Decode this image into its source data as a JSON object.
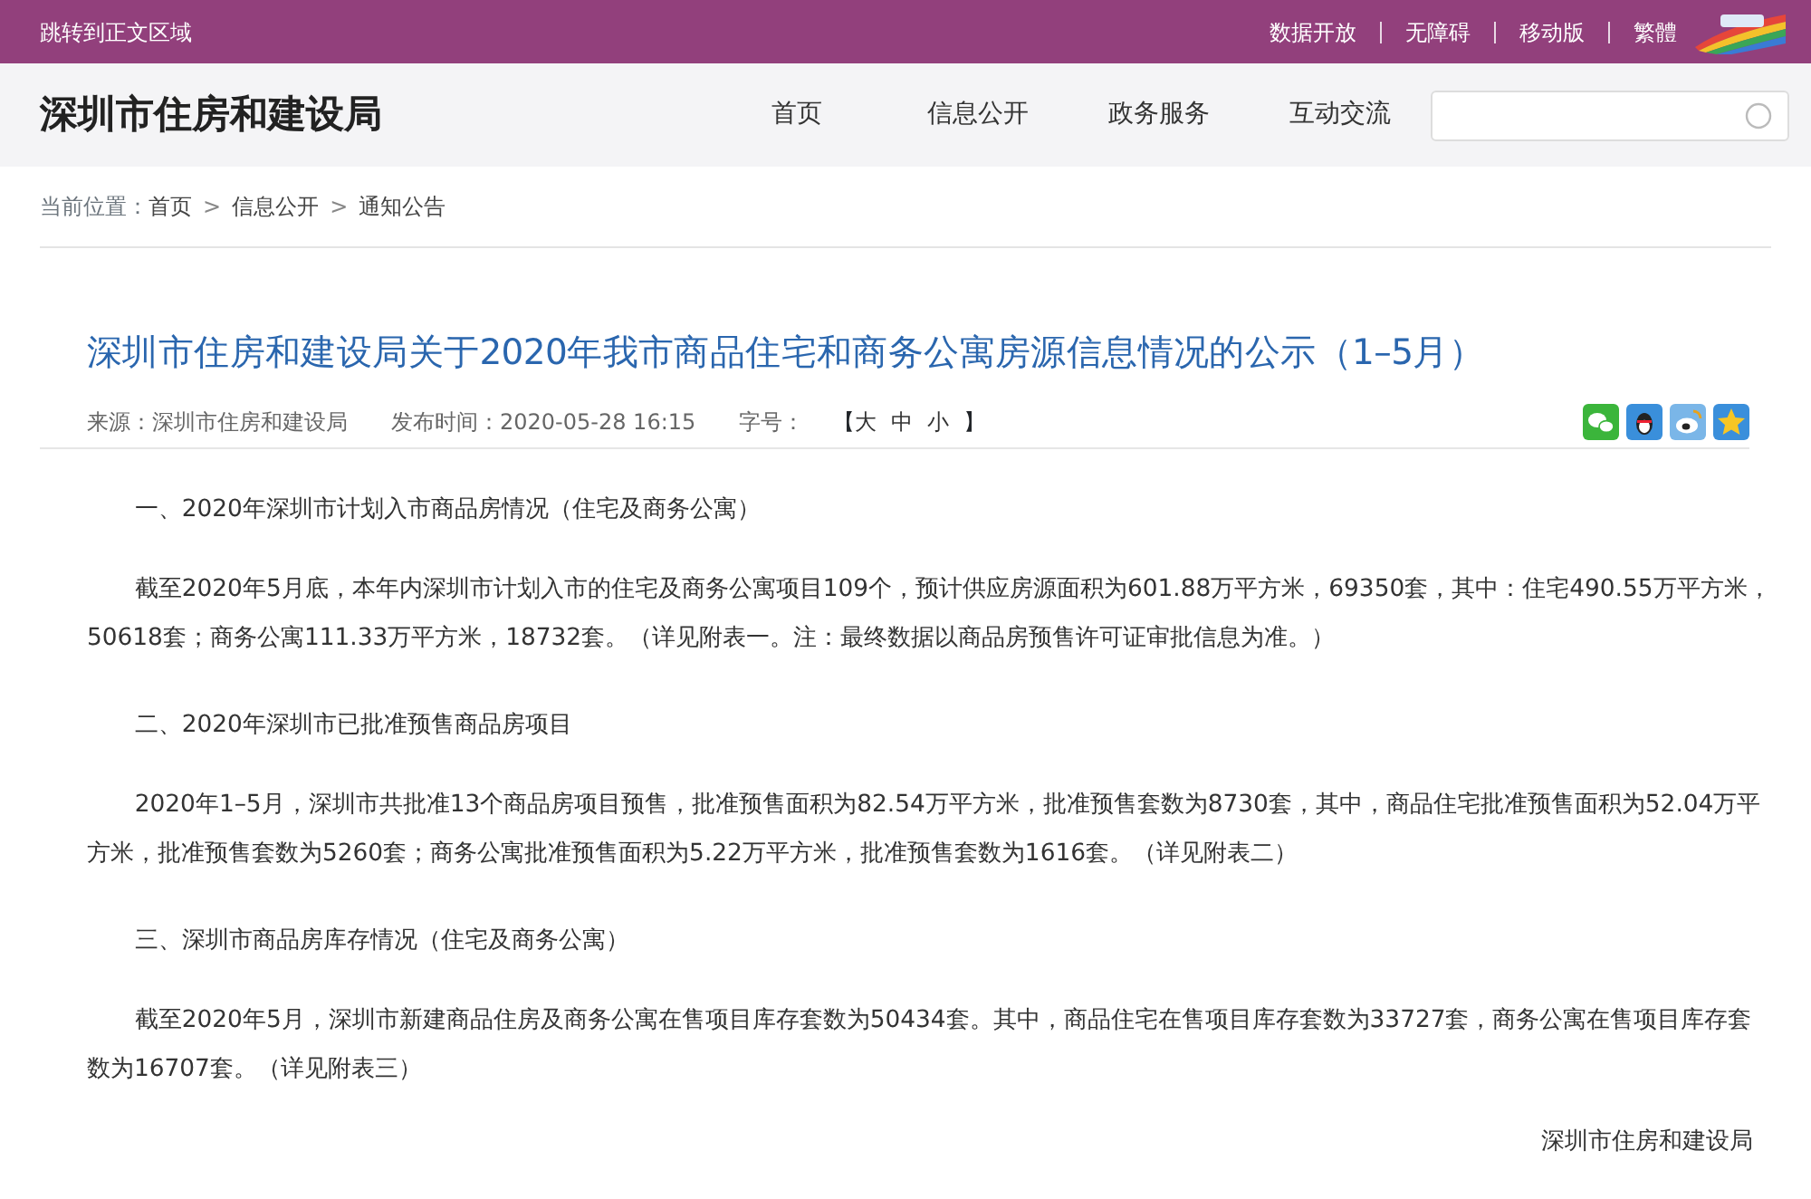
{
  "top_bar": {
    "skip_link": "跳转到正文区域",
    "links": [
      "数据开放",
      "无障碍",
      "移动版",
      "繁體"
    ]
  },
  "header": {
    "site_title": "深圳市住房和建设局",
    "nav": [
      "首页",
      "信息公开",
      "政务服务",
      "互动交流"
    ]
  },
  "breadcrumb": {
    "label": "当前位置：",
    "separator": ">",
    "items": [
      "首页",
      "信息公开",
      "通知公告"
    ]
  },
  "article": {
    "title": "深圳市住房和建设局关于2020年我市商品住宅和商务公寓房源信息情况的公示（1–5月）",
    "meta": {
      "source_label": "来源：",
      "source": "深圳市住房和建设局",
      "time_label": "发布时间：",
      "time": "2020-05-28 16:15",
      "size_label": "字号：",
      "open_bracket": "【",
      "sizes": [
        "大",
        "中",
        "小"
      ],
      "close_bracket": "】"
    },
    "share": [
      {
        "kind": "wechat"
      },
      {
        "kind": "qq"
      },
      {
        "kind": "weibo"
      },
      {
        "kind": "favorite"
      }
    ],
    "paragraphs": [
      {
        "kind": "heading",
        "text": "一、2020年深圳市计划入市商品房情况（住宅及商务公寓）"
      },
      {
        "kind": "body",
        "text": "截至2020年5月底，本年内深圳市计划入市的住宅及商务公寓项目109个，预计供应房源面积为601.88万平方米，69350套，其中：住宅490.55万平方米，50618套；商务公寓111.33万平方米，18732套。（详见附表一。注：最终数据以商品房预售许可证审批信息为准。）"
      },
      {
        "kind": "heading",
        "text": "二、2020年深圳市已批准预售商品房项目"
      },
      {
        "kind": "body",
        "text": "2020年1–5月，深圳市共批准13个商品房项目预售，批准预售面积为82.54万平方米，批准预售套数为8730套，其中，商品住宅批准预售面积为52.04万平方米，批准预售套数为5260套；商务公寓批准预售面积为5.22万平方米，批准预售套数为1616套。（详见附表二）"
      },
      {
        "kind": "heading",
        "text": "三、深圳市商品房库存情况（住宅及商务公寓）"
      },
      {
        "kind": "body",
        "text": "截至2020年5月，深圳市新建商品住房及商务公寓在售项目库存套数为50434套。其中，商品住宅在售项目库存套数为33727套，商务公寓在售项目库存套数为16707套。（详见附表三）"
      }
    ],
    "signature": "深圳市住房和建设局"
  }
}
